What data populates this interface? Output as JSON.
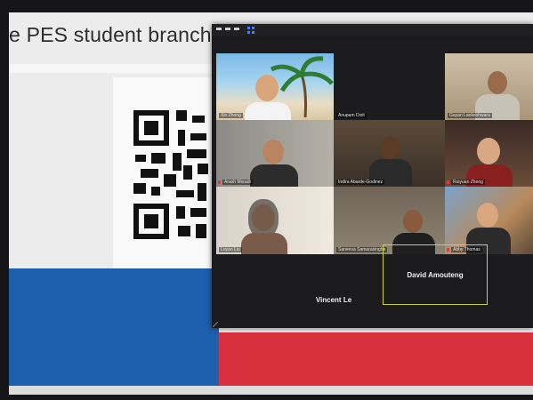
{
  "slide": {
    "title": "e PES student branch"
  },
  "zoom": {
    "participants": [
      {
        "name": "Xin Zhong",
        "muted": false
      },
      {
        "name": "Anupam Dixit",
        "muted": false
      },
      {
        "name": "Gayan Lankeshwara",
        "muted": false
      },
      {
        "name": "Arash Moradi",
        "muted": true
      },
      {
        "name": "Indira Abarde-Godinez",
        "muted": false
      },
      {
        "name": "Ruiyuan Zheng",
        "muted": true
      },
      {
        "name": "Luyao Liu",
        "muted": false
      },
      {
        "name": "Saneeva Samarasinghe",
        "muted": false
      },
      {
        "name": "Abby Thomas",
        "muted": true
      }
    ],
    "bottom_row": {
      "left": "Vincent Le",
      "right": "David Amouteng"
    }
  },
  "colors": {
    "blue_band": "#1e5fae",
    "red_band": "#d9303e",
    "active_speaker_border": "#c8d431"
  }
}
